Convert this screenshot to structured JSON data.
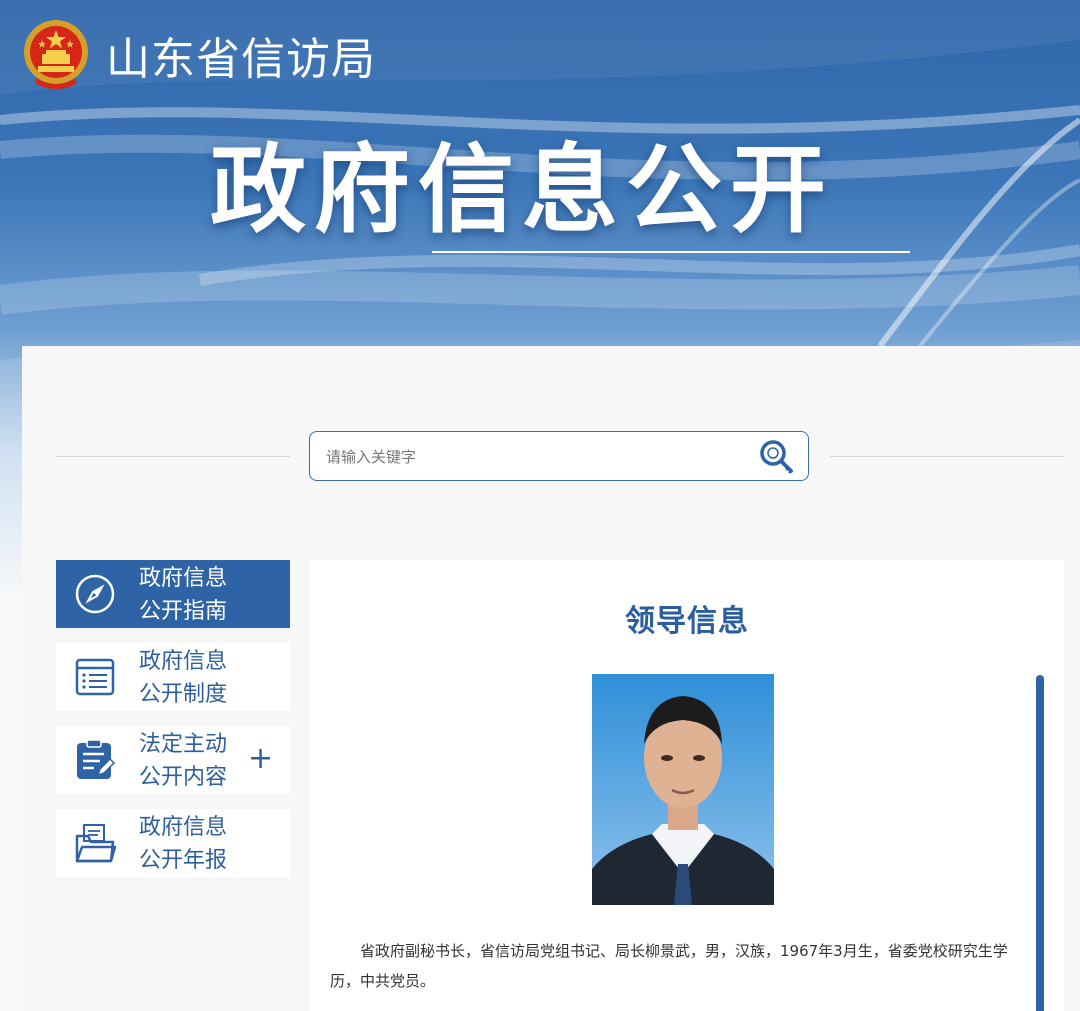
{
  "header": {
    "site_title": "山东省信访局",
    "hero_title": "政府信息公开"
  },
  "search": {
    "placeholder": "请输入关键字"
  },
  "nav": {
    "items": [
      {
        "label": "政府信息\n公开指南",
        "icon": "compass-icon",
        "active": true
      },
      {
        "label": "政府信息\n公开制度",
        "icon": "list-document-icon",
        "active": false
      },
      {
        "label": "法定主动\n公开内容",
        "icon": "clipboard-edit-icon",
        "active": false,
        "expand": "+"
      },
      {
        "label": "政府信息\n公开年报",
        "icon": "folder-document-icon",
        "active": false
      }
    ]
  },
  "content": {
    "title": "领导信息",
    "bio": "省政府副秘书长，省信访局党组书记、局长柳景武，男，汉族，1967年3月生，省委党校研究生学历，中共党员。"
  },
  "colors": {
    "primary": "#2e64a6",
    "title_blue": "#2c5d9d",
    "panel_bg": "#f7f7f7"
  }
}
